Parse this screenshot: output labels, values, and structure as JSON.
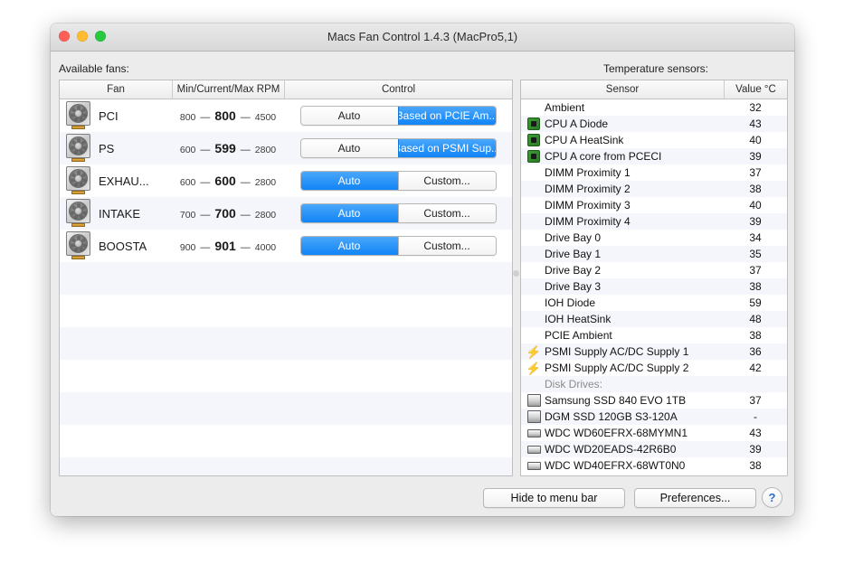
{
  "window": {
    "title": "Macs Fan Control 1.4.3 (MacPro5,1)",
    "traffic_lights": [
      "close-red",
      "minimize-yellow",
      "zoom-green"
    ]
  },
  "fans_section": {
    "label": "Available fans:",
    "columns": [
      "Fan",
      "Min/Current/Max RPM",
      "Control"
    ],
    "rows": [
      {
        "icon": "fan-icon",
        "name": "PCI",
        "min": "800",
        "current": "800",
        "max": "4500",
        "left_button": "Auto",
        "right_button": "Based on PCIE Am...",
        "active": "right"
      },
      {
        "icon": "fan-icon",
        "name": "PS",
        "min": "600",
        "current": "599",
        "max": "2800",
        "left_button": "Auto",
        "right_button": "Based on PSMI Sup...",
        "active": "right"
      },
      {
        "icon": "fan-icon",
        "name": "EXHAU...",
        "min": "600",
        "current": "600",
        "max": "2800",
        "left_button": "Auto",
        "right_button": "Custom...",
        "active": "left"
      },
      {
        "icon": "fan-icon",
        "name": "INTAKE",
        "min": "700",
        "current": "700",
        "max": "2800",
        "left_button": "Auto",
        "right_button": "Custom...",
        "active": "left"
      },
      {
        "icon": "fan-icon",
        "name": "BOOSTA",
        "min": "900",
        "current": "901",
        "max": "4000",
        "left_button": "Auto",
        "right_button": "Custom...",
        "active": "left"
      }
    ],
    "empty_row_count": 7,
    "dash": "—"
  },
  "sensors_section": {
    "label": "Temperature sensors:",
    "columns": [
      "Sensor",
      "Value °C"
    ],
    "rows": [
      {
        "icon": "none",
        "name": "Ambient",
        "value": "32"
      },
      {
        "icon": "cpu-icon",
        "name": "CPU A Diode",
        "value": "43"
      },
      {
        "icon": "cpu-icon",
        "name": "CPU A HeatSink",
        "value": "40"
      },
      {
        "icon": "cpu-icon",
        "name": "CPU A core from PCECI",
        "value": "39"
      },
      {
        "icon": "none",
        "name": "DIMM Proximity 1",
        "value": "37"
      },
      {
        "icon": "none",
        "name": "DIMM Proximity 2",
        "value": "38"
      },
      {
        "icon": "none",
        "name": "DIMM Proximity 3",
        "value": "40"
      },
      {
        "icon": "none",
        "name": "DIMM Proximity 4",
        "value": "39"
      },
      {
        "icon": "none",
        "name": "Drive Bay 0",
        "value": "34"
      },
      {
        "icon": "none",
        "name": "Drive Bay 1",
        "value": "35"
      },
      {
        "icon": "none",
        "name": "Drive Bay 2",
        "value": "37"
      },
      {
        "icon": "none",
        "name": "Drive Bay 3",
        "value": "38"
      },
      {
        "icon": "none",
        "name": "IOH Diode",
        "value": "59"
      },
      {
        "icon": "none",
        "name": "IOH HeatSink",
        "value": "48"
      },
      {
        "icon": "none",
        "name": "PCIE Ambient",
        "value": "38"
      },
      {
        "icon": "bolt-icon",
        "name": "PSMI Supply AC/DC Supply 1",
        "value": "36"
      },
      {
        "icon": "bolt-icon",
        "name": "PSMI Supply AC/DC Supply 2",
        "value": "42"
      },
      {
        "icon": "none",
        "name": "Disk Drives:",
        "value": "",
        "group": true
      },
      {
        "icon": "ssd-icon",
        "name": "Samsung SSD 840 EVO 1TB",
        "value": "37"
      },
      {
        "icon": "ssd-icon",
        "name": "DGM SSD 120GB S3-120A",
        "value": "-"
      },
      {
        "icon": "hdd-icon",
        "name": "WDC WD60EFRX-68MYMN1",
        "value": "43"
      },
      {
        "icon": "hdd-icon",
        "name": "WDC WD20EADS-42R6B0",
        "value": "39"
      },
      {
        "icon": "hdd-icon",
        "name": "WDC WD40EFRX-68WT0N0",
        "value": "38"
      }
    ]
  },
  "footer": {
    "hide_button": "Hide to menu bar",
    "preferences_button": "Preferences...",
    "help_button": "?"
  },
  "colors": {
    "accent_blue": "#1184f5",
    "window_bg": "#ececec",
    "row_stripe": "#f5f6fb",
    "cpu_green": "#3f9b37",
    "bolt_yellow": "#f2c21a"
  }
}
